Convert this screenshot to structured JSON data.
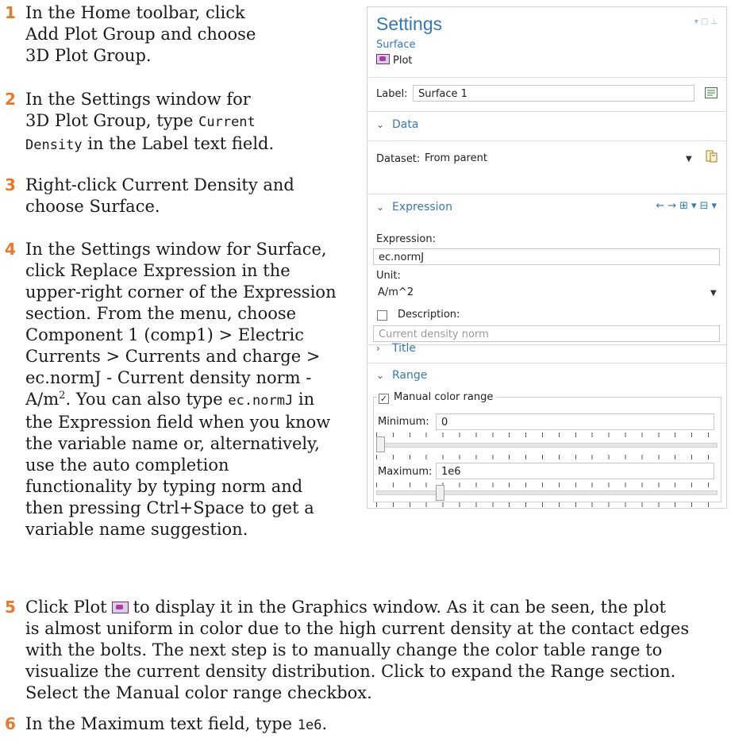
{
  "steps": [
    {
      "num": "1",
      "lines": [
        "In the Home toolbar, click",
        "Add Plot Group and choose",
        "3D Plot Group."
      ]
    },
    {
      "num": "2",
      "lines": [
        "In the Settings window for",
        "3D Plot Group, type",
        "in the Label text field."
      ],
      "code1": "Current",
      "code2": "Density"
    },
    {
      "num": "3",
      "lines": [
        "Right-click Current Density and",
        "choose Surface."
      ]
    },
    {
      "num": "4",
      "lines": [
        "In the Settings window for Surface,",
        "click Replace Expression in the",
        "upper-right corner of the Expression",
        "section. From the menu, choose",
        "Component 1 (comp1) > Electric",
        "Currents > Currents and charge >",
        "ec.normJ - Current density norm -",
        "A/m",
        ". You can also type",
        "in",
        "the Expression field when you know",
        "the variable name or, alternatively,",
        "use the auto completion",
        "functionality by typing norm and",
        "then pressing Ctrl+Space to get a",
        "variable name suggestion."
      ],
      "sup": "2",
      "code": "ec.normJ"
    },
    {
      "num": "5",
      "lead": "Click Plot",
      "lines": [
        "to display it in the Graphics window. As it can be seen, the plot",
        "is almost uniform in color due to the high current density at the contact edges",
        "with the bolts. The next step is to manually change the color table range to",
        "visualize the current density distribution. Click to expand the Range section.",
        "Select the Manual color range checkbox."
      ]
    },
    {
      "num": "6",
      "lead": "In the Maximum text field, type",
      "code": "1e6",
      "tail": "."
    }
  ],
  "panel": {
    "title": "Settings",
    "subtitle": "Surface",
    "plot_label": "Plot",
    "label_caption": "Label:",
    "label_value": "Surface 1",
    "sections": {
      "data": "Data",
      "expression": "Expression",
      "title": "Title",
      "range": "Range"
    },
    "dataset_caption": "Dataset:",
    "dataset_value": "From parent",
    "expression_caption": "Expression:",
    "expression_value": "ec.normJ",
    "unit_caption": "Unit:",
    "unit_value": "A/m^2",
    "description_caption": "Description:",
    "description_placeholder": "Current density norm",
    "description_checked": false,
    "manual_range_caption": "Manual color range",
    "manual_range_checked": true,
    "minimum_caption": "Minimum:",
    "minimum_value": "0",
    "maximum_caption": "Maximum:",
    "maximum_value": "1e6",
    "minimum_slider_fraction": 0.0,
    "maximum_slider_fraction": 0.18
  },
  "colors": {
    "step_number": "#e8792b",
    "panel_accent": "#3579b8"
  }
}
